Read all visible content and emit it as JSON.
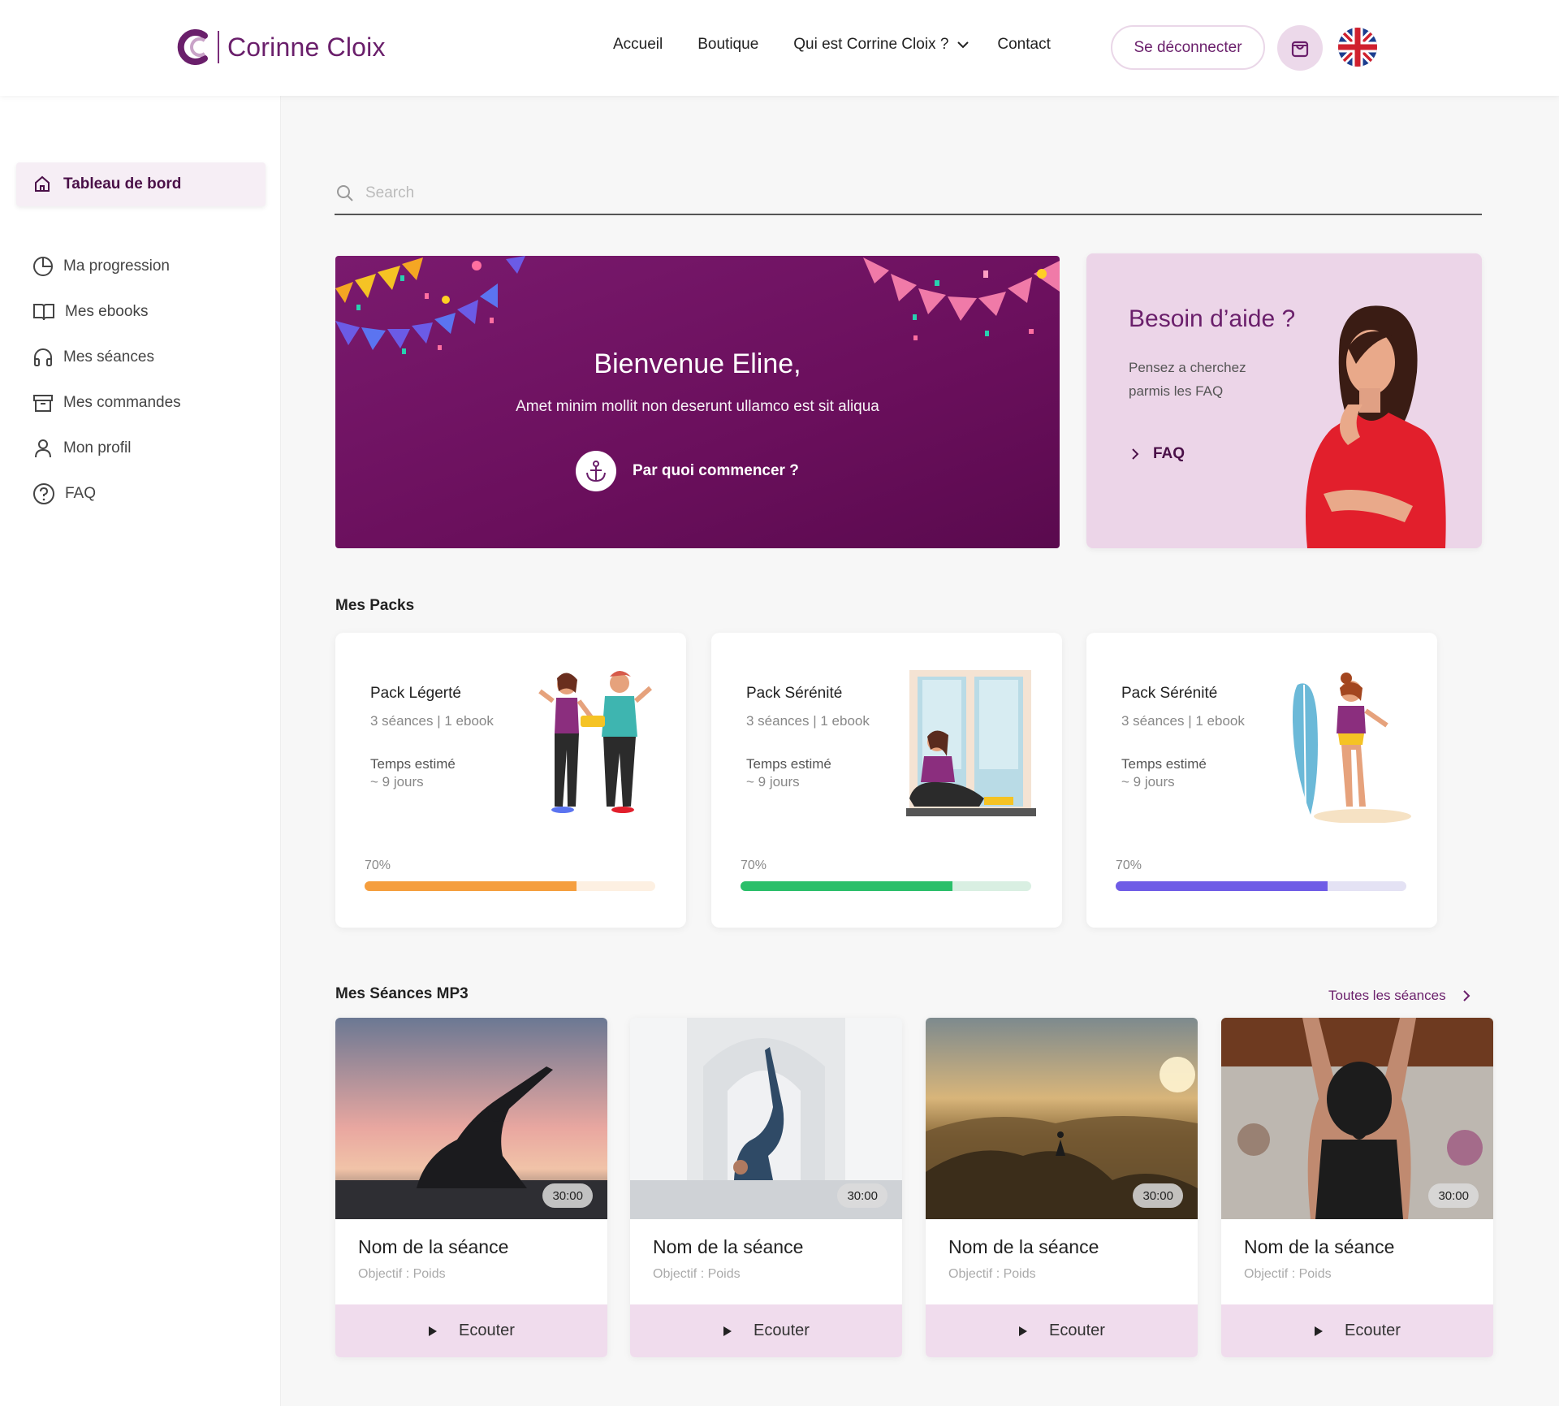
{
  "header": {
    "logo_text": "Corinne Cloix",
    "nav": [
      "Accueil",
      "Boutique",
      "Qui est Corrine Cloix ?",
      "Contact"
    ],
    "logout_label": "Se déconnecter"
  },
  "sidebar": {
    "active": "Tableau de bord",
    "items": [
      {
        "label": "Ma progression",
        "icon": "pie-chart-icon"
      },
      {
        "label": "Mes ebooks",
        "icon": "book-icon"
      },
      {
        "label": "Mes séances",
        "icon": "headphones-icon"
      },
      {
        "label": "Mes commandes",
        "icon": "archive-icon"
      },
      {
        "label": "Mon profil",
        "icon": "user-icon"
      },
      {
        "label": "FAQ",
        "icon": "help-circle-icon"
      }
    ]
  },
  "search": {
    "placeholder": "Search"
  },
  "welcome": {
    "title": "Bienvenue Eline,",
    "subtitle": "Amet minim mollit non deserunt ullamco est sit aliqua",
    "cta": "Par quoi commencer ?"
  },
  "help": {
    "title": "Besoin d’aide ?",
    "text": "Pensez a cherchez parmis les FAQ",
    "link": "FAQ"
  },
  "packs": {
    "title": "Mes Packs",
    "items": [
      {
        "name": "Pack Légerté",
        "meta": "3 séances | 1 ebook",
        "time_label": "Temps estimé",
        "time_value": "~ 9 jours",
        "progress": "70%",
        "color": "#f59e3e",
        "track": "#fdf0e2"
      },
      {
        "name": "Pack Sérénité",
        "meta": "3 séances | 1 ebook",
        "time_label": "Temps estimé",
        "time_value": "~ 9 jours",
        "progress": "70%",
        "color": "#2bbf6a",
        "track": "#d9efe2"
      },
      {
        "name": "Pack Sérénité",
        "meta": "3 séances | 1 ebook",
        "time_label": "Temps estimé",
        "time_value": "~ 9 jours",
        "progress": "70%",
        "color": "#6f5ce6",
        "track": "#e4e2f4"
      }
    ]
  },
  "sessions": {
    "title": "Mes Séances MP3",
    "see_all": "Toutes les séances",
    "items": [
      {
        "duration": "30:00",
        "name": "Nom de la séance",
        "objective": "Objectif : Poids",
        "button": "Ecouter"
      },
      {
        "duration": "30:00",
        "name": "Nom de la séance",
        "objective": "Objectif : Poids",
        "button": "Ecouter"
      },
      {
        "duration": "30:00",
        "name": "Nom de la séance",
        "objective": "Objectif : Poids",
        "button": "Ecouter"
      },
      {
        "duration": "30:00",
        "name": "Nom de la séance",
        "objective": "Objectif : Poids",
        "button": "Ecouter"
      }
    ]
  },
  "colors": {
    "brand": "#6a1f6b",
    "brand_light": "#ecd5e8"
  }
}
